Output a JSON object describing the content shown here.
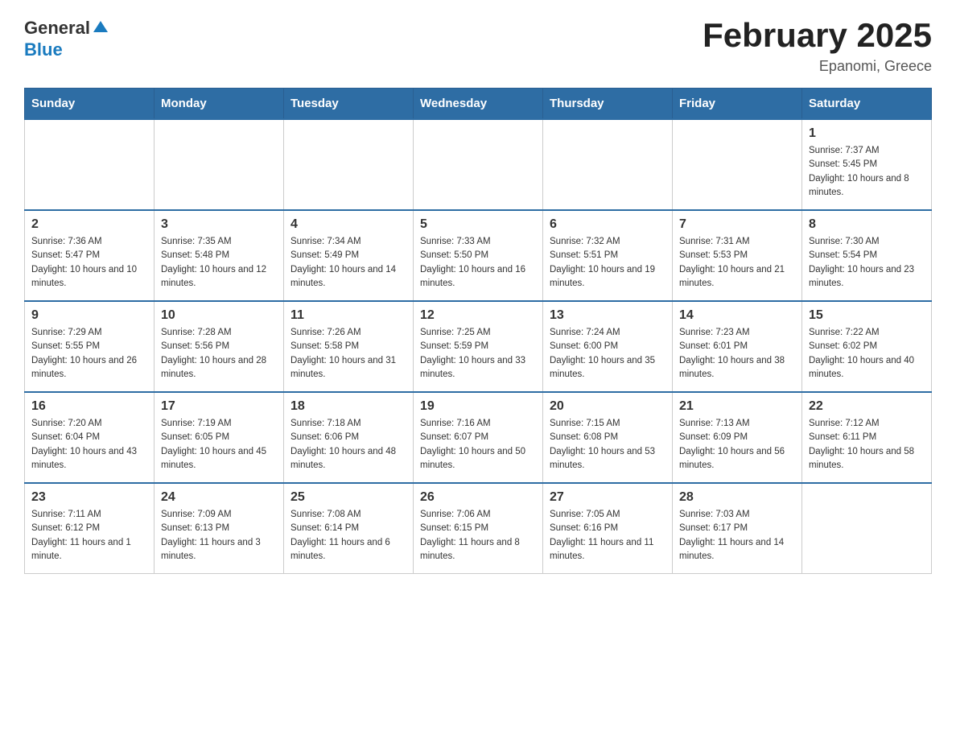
{
  "header": {
    "logo_general": "General",
    "logo_blue": "Blue",
    "title": "February 2025",
    "subtitle": "Epanomi, Greece"
  },
  "days_of_week": [
    "Sunday",
    "Monday",
    "Tuesday",
    "Wednesday",
    "Thursday",
    "Friday",
    "Saturday"
  ],
  "weeks": [
    {
      "days": [
        {
          "date": "",
          "info": ""
        },
        {
          "date": "",
          "info": ""
        },
        {
          "date": "",
          "info": ""
        },
        {
          "date": "",
          "info": ""
        },
        {
          "date": "",
          "info": ""
        },
        {
          "date": "",
          "info": ""
        },
        {
          "date": "1",
          "info": "Sunrise: 7:37 AM\nSunset: 5:45 PM\nDaylight: 10 hours and 8 minutes."
        }
      ]
    },
    {
      "days": [
        {
          "date": "2",
          "info": "Sunrise: 7:36 AM\nSunset: 5:47 PM\nDaylight: 10 hours and 10 minutes."
        },
        {
          "date": "3",
          "info": "Sunrise: 7:35 AM\nSunset: 5:48 PM\nDaylight: 10 hours and 12 minutes."
        },
        {
          "date": "4",
          "info": "Sunrise: 7:34 AM\nSunset: 5:49 PM\nDaylight: 10 hours and 14 minutes."
        },
        {
          "date": "5",
          "info": "Sunrise: 7:33 AM\nSunset: 5:50 PM\nDaylight: 10 hours and 16 minutes."
        },
        {
          "date": "6",
          "info": "Sunrise: 7:32 AM\nSunset: 5:51 PM\nDaylight: 10 hours and 19 minutes."
        },
        {
          "date": "7",
          "info": "Sunrise: 7:31 AM\nSunset: 5:53 PM\nDaylight: 10 hours and 21 minutes."
        },
        {
          "date": "8",
          "info": "Sunrise: 7:30 AM\nSunset: 5:54 PM\nDaylight: 10 hours and 23 minutes."
        }
      ]
    },
    {
      "days": [
        {
          "date": "9",
          "info": "Sunrise: 7:29 AM\nSunset: 5:55 PM\nDaylight: 10 hours and 26 minutes."
        },
        {
          "date": "10",
          "info": "Sunrise: 7:28 AM\nSunset: 5:56 PM\nDaylight: 10 hours and 28 minutes."
        },
        {
          "date": "11",
          "info": "Sunrise: 7:26 AM\nSunset: 5:58 PM\nDaylight: 10 hours and 31 minutes."
        },
        {
          "date": "12",
          "info": "Sunrise: 7:25 AM\nSunset: 5:59 PM\nDaylight: 10 hours and 33 minutes."
        },
        {
          "date": "13",
          "info": "Sunrise: 7:24 AM\nSunset: 6:00 PM\nDaylight: 10 hours and 35 minutes."
        },
        {
          "date": "14",
          "info": "Sunrise: 7:23 AM\nSunset: 6:01 PM\nDaylight: 10 hours and 38 minutes."
        },
        {
          "date": "15",
          "info": "Sunrise: 7:22 AM\nSunset: 6:02 PM\nDaylight: 10 hours and 40 minutes."
        }
      ]
    },
    {
      "days": [
        {
          "date": "16",
          "info": "Sunrise: 7:20 AM\nSunset: 6:04 PM\nDaylight: 10 hours and 43 minutes."
        },
        {
          "date": "17",
          "info": "Sunrise: 7:19 AM\nSunset: 6:05 PM\nDaylight: 10 hours and 45 minutes."
        },
        {
          "date": "18",
          "info": "Sunrise: 7:18 AM\nSunset: 6:06 PM\nDaylight: 10 hours and 48 minutes."
        },
        {
          "date": "19",
          "info": "Sunrise: 7:16 AM\nSunset: 6:07 PM\nDaylight: 10 hours and 50 minutes."
        },
        {
          "date": "20",
          "info": "Sunrise: 7:15 AM\nSunset: 6:08 PM\nDaylight: 10 hours and 53 minutes."
        },
        {
          "date": "21",
          "info": "Sunrise: 7:13 AM\nSunset: 6:09 PM\nDaylight: 10 hours and 56 minutes."
        },
        {
          "date": "22",
          "info": "Sunrise: 7:12 AM\nSunset: 6:11 PM\nDaylight: 10 hours and 58 minutes."
        }
      ]
    },
    {
      "days": [
        {
          "date": "23",
          "info": "Sunrise: 7:11 AM\nSunset: 6:12 PM\nDaylight: 11 hours and 1 minute."
        },
        {
          "date": "24",
          "info": "Sunrise: 7:09 AM\nSunset: 6:13 PM\nDaylight: 11 hours and 3 minutes."
        },
        {
          "date": "25",
          "info": "Sunrise: 7:08 AM\nSunset: 6:14 PM\nDaylight: 11 hours and 6 minutes."
        },
        {
          "date": "26",
          "info": "Sunrise: 7:06 AM\nSunset: 6:15 PM\nDaylight: 11 hours and 8 minutes."
        },
        {
          "date": "27",
          "info": "Sunrise: 7:05 AM\nSunset: 6:16 PM\nDaylight: 11 hours and 11 minutes."
        },
        {
          "date": "28",
          "info": "Sunrise: 7:03 AM\nSunset: 6:17 PM\nDaylight: 11 hours and 14 minutes."
        },
        {
          "date": "",
          "info": ""
        }
      ]
    }
  ]
}
